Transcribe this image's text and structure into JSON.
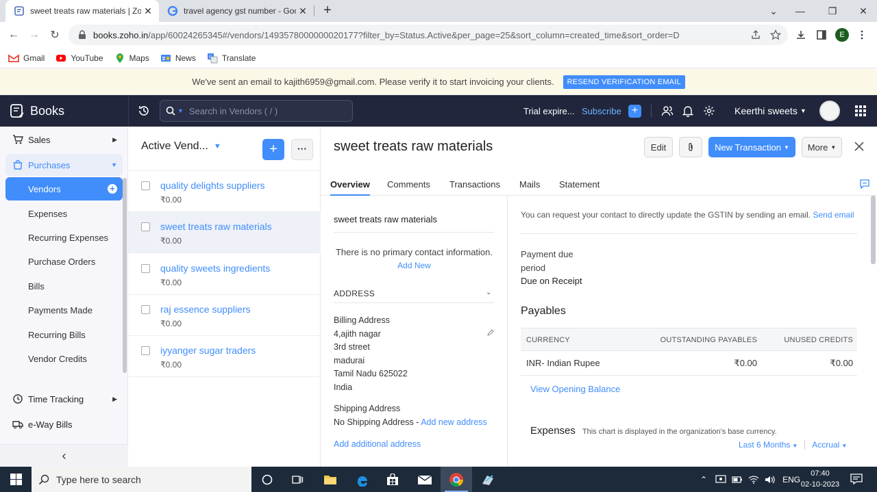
{
  "browser": {
    "tabs": [
      {
        "title": "sweet treats raw materials | Zoho",
        "active": true
      },
      {
        "title": "travel agency gst number - Goo",
        "active": false
      }
    ],
    "url_host": "books.zoho.in",
    "url_rest": "/app/60024265345#/vendors/1493578000000020177?filter_by=Status.Active&per_page=25&sort_column=created_time&sort_order=D",
    "profile_initial": "E",
    "bookmarks": [
      "Gmail",
      "YouTube",
      "Maps",
      "News",
      "Translate"
    ]
  },
  "notice": {
    "text": "We've sent an email to kajith6959@gmail.com. Please verify it to start invoicing your clients.",
    "button": "RESEND VERIFICATION EMAIL"
  },
  "header": {
    "brand": "Books",
    "search_placeholder": "Search in Vendors ( / )",
    "trial": "Trial expire...",
    "subscribe": "Subscribe",
    "org": "Keerthi sweets"
  },
  "sidebar": {
    "sales": "Sales",
    "purchases": "Purchases",
    "items": [
      "Vendors",
      "Expenses",
      "Recurring Expenses",
      "Purchase Orders",
      "Bills",
      "Payments Made",
      "Recurring Bills",
      "Vendor Credits"
    ],
    "time_tracking": "Time Tracking",
    "eway": "e-Way Bills"
  },
  "list": {
    "title": "Active Vend...",
    "rows": [
      {
        "name": "quality delights suppliers",
        "amount": "₹0.00"
      },
      {
        "name": "sweet treats raw materials",
        "amount": "₹0.00"
      },
      {
        "name": "quality sweets ingredients",
        "amount": "₹0.00"
      },
      {
        "name": "raj essence suppliers",
        "amount": "₹0.00"
      },
      {
        "name": "iyyanger sugar traders",
        "amount": "₹0.00"
      }
    ]
  },
  "detail": {
    "title": "sweet treats raw materials",
    "edit": "Edit",
    "new_transaction": "New Transaction",
    "more": "More",
    "tabs": [
      "Overview",
      "Comments",
      "Transactions",
      "Mails",
      "Statement"
    ],
    "vendor_name": "sweet treats raw materials",
    "no_contact": "There is no primary contact information.",
    "add_new": "Add New",
    "address_header": "ADDRESS",
    "billing_label": "Billing Address",
    "billing_lines": [
      "4,ajith nagar",
      "3rd street",
      "madurai",
      "Tamil Nadu 625022",
      "India"
    ],
    "shipping_label": "Shipping Address",
    "no_shipping": "No Shipping Address -",
    "add_new_address": "Add new address",
    "add_additional": "Add additional address",
    "gst_text": "You can request your contact to directly update the GSTIN by sending an email.",
    "send_email": "Send email",
    "payment_due_1": "Payment due",
    "payment_due_2": "period",
    "payment_due_value": "Due on Receipt",
    "payables": "Payables",
    "table": {
      "headers": [
        "CURRENCY",
        "OUTSTANDING PAYABLES",
        "UNUSED CREDITS"
      ],
      "rows": [
        [
          "INR- Indian Rupee",
          "₹0.00",
          "₹0.00"
        ]
      ]
    },
    "view_opening": "View Opening Balance",
    "expenses": "Expenses",
    "expenses_note": "This chart is displayed in the organization's base currency.",
    "filter_period": "Last 6 Months",
    "filter_basis": "Accrual"
  },
  "taskbar": {
    "search_placeholder": "Type here to search",
    "lang": "ENG",
    "time": "07:40",
    "date": "02-10-2023"
  },
  "colors": {
    "accent": "#408dfb",
    "header_bg": "#21263c"
  }
}
